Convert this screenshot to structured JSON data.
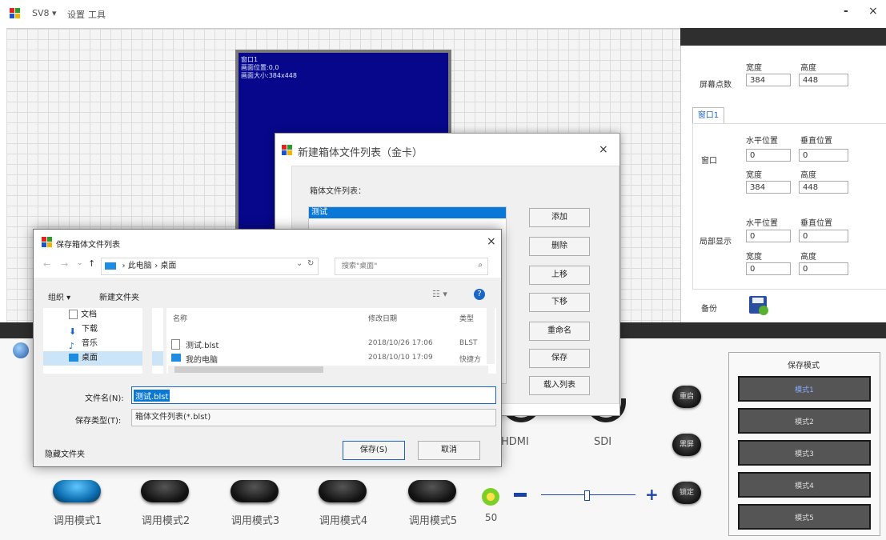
{
  "topbar": {
    "menu": [
      "SV8 ▾",
      "设置",
      "工具"
    ],
    "minimize": "-",
    "close": "×"
  },
  "screen_window": {
    "lines": [
      "窗口1",
      "画面位置:0,0",
      "画面大小:384x448"
    ]
  },
  "right_panel": {
    "screen_points_label": "屏幕点数",
    "width_label": "宽度",
    "height_label": "高度",
    "screen_width": "384",
    "screen_height": "448",
    "tab": "窗口1",
    "window_label": "窗口",
    "hpos_label": "水平位置",
    "vpos_label": "垂直位置",
    "win_h": "0",
    "win_v": "0",
    "win_w": "384",
    "win_hh": "448",
    "local_label": "局部显示",
    "loc_h": "0",
    "loc_v": "0",
    "loc_w": "0",
    "loc_hh": "0",
    "backup_label": "备份"
  },
  "modes": [
    "调用模式1",
    "调用模式2",
    "调用模式3",
    "调用模式4",
    "调用模式5"
  ],
  "brightness_value": "50",
  "inputs": {
    "hdmi": "HDMI",
    "sdi": "SDI"
  },
  "round_buttons": [
    "重启",
    "黑屏",
    "锁定"
  ],
  "save_panel": {
    "title": "保存模式",
    "modes": [
      "模式1",
      "模式2",
      "模式3",
      "模式4",
      "模式5"
    ]
  },
  "dialog1": {
    "title": "新建箱体文件列表（金卡）",
    "close": "×",
    "list_label": "箱体文件列表：",
    "list_items": [
      "测试"
    ],
    "buttons": [
      "添加",
      "删除",
      "上移",
      "下移",
      "重命名",
      "保存",
      "载入列表"
    ]
  },
  "dialog2": {
    "title": "保存箱体文件列表",
    "close": "×",
    "path": [
      "此电脑",
      "桌面"
    ],
    "search_placeholder": "搜索\"桌面\"",
    "organize": "组织 ▾",
    "new_folder": "新建文件夹",
    "tree": [
      "文档",
      "下载",
      "音乐",
      "桌面"
    ],
    "columns": [
      "名称",
      "修改日期",
      "类型"
    ],
    "files": [
      {
        "name": "测试.blst",
        "date": "2018/10/26 17:06",
        "type": "BLST"
      },
      {
        "name": "我的电脑",
        "date": "2018/10/10 17:09",
        "type": "快捷方"
      }
    ],
    "filename_label": "文件名(N):",
    "filename_value": "测试.blst",
    "filetype_label": "保存类型(T):",
    "filetype_value": "箱体文件列表(*.blst)",
    "hide_folders": "隐藏文件夹",
    "save": "保存(S)",
    "cancel": "取消"
  },
  "colors": {
    "screen_blue": "#07078c",
    "accent_blue": "#1c55c8",
    "selection": "#0a78d7"
  }
}
